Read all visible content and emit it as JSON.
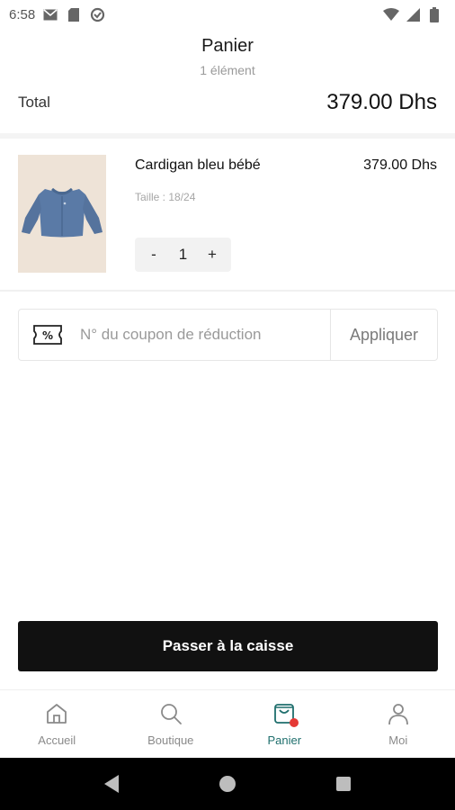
{
  "status_bar": {
    "time": "6:58",
    "icons": [
      "gmail-icon",
      "sim-card-icon",
      "sync-icon",
      "wifi-icon",
      "signal-icon",
      "battery-icon"
    ]
  },
  "header": {
    "title": "Panier",
    "subtitle": "1 élément"
  },
  "summary": {
    "total_label": "Total",
    "total_value": "379.00 Dhs"
  },
  "cart": {
    "items": [
      {
        "name": "Cardigan bleu bébé",
        "price": "379.00 Dhs",
        "size": "Taille : 18/24",
        "quantity": "1",
        "minus_label": "-",
        "plus_label": "+",
        "image": "blue-baby-cardigan"
      }
    ]
  },
  "coupon": {
    "placeholder": "N° du coupon de réduction",
    "value": "",
    "apply_label": "Appliquer"
  },
  "checkout": {
    "label": "Passer à la caisse"
  },
  "bottom_nav": {
    "items": [
      {
        "label": "Accueil",
        "icon": "home-icon"
      },
      {
        "label": "Boutique",
        "icon": "search-icon"
      },
      {
        "label": "Panier",
        "icon": "shopping-bag-icon",
        "active": true
      },
      {
        "label": "Moi",
        "icon": "user-icon"
      }
    ]
  },
  "colors": {
    "accent": "#1f6f6d",
    "badge": "#e53935",
    "checkout_bg": "#111111"
  }
}
